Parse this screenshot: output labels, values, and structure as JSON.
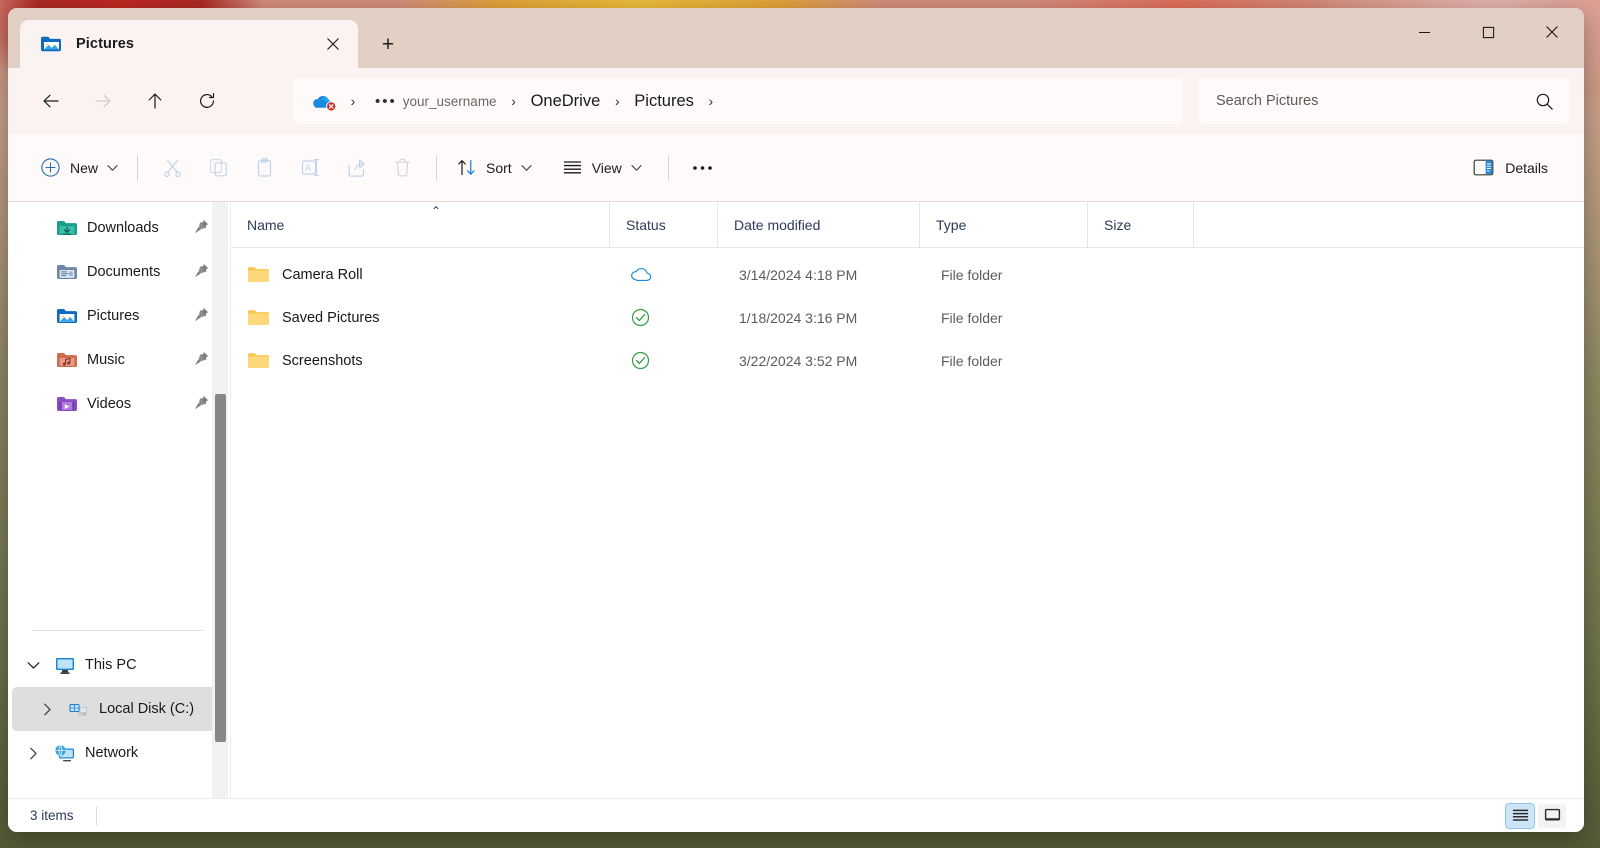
{
  "window": {
    "controls": {
      "minimize": "–",
      "maximize": "□",
      "close": "✕"
    }
  },
  "tabbar": {
    "tabs": [
      {
        "label": "Pictures",
        "icon": "pictures-folder-icon",
        "close": "✕"
      }
    ],
    "new_tab": "+"
  },
  "navigation": {
    "back": "←",
    "forward": "→",
    "up": "↑",
    "refresh": "⟳"
  },
  "breadcrumb": {
    "root_icon": "onedrive-error-icon",
    "separator": "›",
    "overflow": "•••",
    "items": [
      {
        "label": "your_username",
        "style": "muted"
      },
      {
        "label": "OneDrive",
        "style": "big"
      },
      {
        "label": "Pictures",
        "style": "big"
      }
    ]
  },
  "search": {
    "placeholder": "Search Pictures",
    "value": "",
    "icon": "search-icon"
  },
  "toolbar": {
    "new_label": "New",
    "cut_label": "Cut",
    "copy_label": "Copy",
    "paste_label": "Paste",
    "rename_label": "Rename",
    "share_label": "Share",
    "delete_label": "Delete",
    "sort_label": "Sort",
    "view_label": "View",
    "more_label": "•••",
    "details_label": "Details"
  },
  "sidebar": {
    "quick_access": [
      {
        "label": "Downloads",
        "icon": "downloads-folder-icon",
        "pinned": true
      },
      {
        "label": "Documents",
        "icon": "documents-folder-icon",
        "pinned": true
      },
      {
        "label": "Pictures",
        "icon": "pictures-folder-icon",
        "pinned": true
      },
      {
        "label": "Music",
        "icon": "music-folder-icon",
        "pinned": true
      },
      {
        "label": "Videos",
        "icon": "videos-folder-icon",
        "pinned": true
      }
    ],
    "tree": [
      {
        "label": "This PC",
        "icon": "this-pc-icon",
        "expanded": true,
        "chevron": "⌄",
        "selected": false,
        "indent": 0
      },
      {
        "label": "Local Disk (C:)",
        "icon": "local-disk-icon",
        "expanded": false,
        "chevron": "›",
        "selected": true,
        "indent": 1
      },
      {
        "label": "Network",
        "icon": "network-icon",
        "expanded": false,
        "chevron": "›",
        "selected": false,
        "indent": 0
      }
    ]
  },
  "filelist": {
    "columns": [
      {
        "key": "name",
        "label": "Name",
        "sorted": "asc",
        "caret": "⌃"
      },
      {
        "key": "status",
        "label": "Status"
      },
      {
        "key": "date",
        "label": "Date modified"
      },
      {
        "key": "type",
        "label": "Type"
      },
      {
        "key": "size",
        "label": "Size"
      }
    ],
    "rows": [
      {
        "name": "Camera Roll",
        "status_icon": "cloud-online-only-icon",
        "date": "3/14/2024 4:18 PM",
        "type": "File folder",
        "size": ""
      },
      {
        "name": "Saved Pictures",
        "status_icon": "green-check-available-icon",
        "date": "1/18/2024 3:16 PM",
        "type": "File folder",
        "size": ""
      },
      {
        "name": "Screenshots",
        "status_icon": "green-check-available-icon",
        "date": "3/22/2024 3:52 PM",
        "type": "File folder",
        "size": ""
      }
    ]
  },
  "statusbar": {
    "item_count": "3 items",
    "view_details": "details-view-icon",
    "view_thumbnail": "large-icons-view-icon"
  },
  "colors": {
    "titlebar": "#e2d0c5",
    "toolbar": "#fbf3f1",
    "accent_blue": "#0f6cbd",
    "folder_yellow": "#fbc955",
    "cloud_blue": "#1a8ae0",
    "check_green": "#2f9e44",
    "selected_row": "#dedede",
    "header_text": "#2d3b57"
  }
}
